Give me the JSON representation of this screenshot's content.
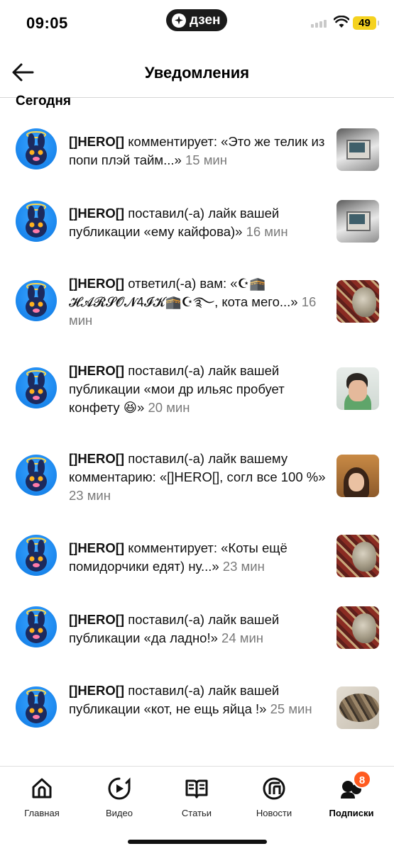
{
  "status_bar": {
    "time": "09:05",
    "app_pill_label": "дзен",
    "battery": "49",
    "battery_color": "#f5d21f"
  },
  "header": {
    "title": "Уведомления",
    "back_icon": "arrow-left-icon"
  },
  "section_title": "Сегодня",
  "notifications": [
    {
      "author": "[]HERO[]",
      "text": " комментирует: «Это же телик из попи плэй тайм...»",
      "time": " 15 мин",
      "thumb": "computer"
    },
    {
      "author": "[]HERO[]",
      "text": " поставил(-а) лайк вашей публикации «ему кайфова)»",
      "time": " 16 мин",
      "thumb": "computer"
    },
    {
      "author": "[]HERO[]",
      "text": " ответил(-а) вам: «☪🕋 𝓗𝓐𝓡𝓢𝓞𝓝4𝓘𝓚🕋☪࿐, кота мего...»",
      "time": " 16 мин",
      "thumb": "carpet-cat"
    },
    {
      "author": "[]HERO[]",
      "text": " поставил(-а) лайк вашей публикации «мои др ильяс пробует конфету 😆»",
      "time": " 20 мин",
      "thumb": "boy"
    },
    {
      "author": "[]HERO[]",
      "text": " поставил(-а) лайк вашему комментарию: «[]HERO[], согл все 100 %»",
      "time": " 23 мин",
      "thumb": "girl"
    },
    {
      "author": "[]HERO[]",
      "text": " комментирует: «Коты ещё помидорчики едят) ну...»",
      "time": " 23 мин",
      "thumb": "carpet-cat"
    },
    {
      "author": "[]HERO[]",
      "text": " поставил(-а) лайк вашей публикации «да ладно!»",
      "time": " 24 мин",
      "thumb": "carpet-cat"
    },
    {
      "author": "[]HERO[]",
      "text": " поставил(-а) лайк вашей публикации «кот, не ещь яйца !»",
      "time": " 25 мин",
      "thumb": "cat"
    }
  ],
  "bottom_nav": [
    {
      "label": "Главная",
      "icon": "home-icon"
    },
    {
      "label": "Видео",
      "icon": "video-play-icon"
    },
    {
      "label": "Статьи",
      "icon": "book-icon"
    },
    {
      "label": "Новости",
      "icon": "news-icon"
    },
    {
      "label": "Подписки",
      "icon": "subscriptions-icon",
      "badge": "8",
      "active": true
    }
  ],
  "colors": {
    "badge": "#ff5a1f",
    "time_text": "#7a7a7a"
  }
}
